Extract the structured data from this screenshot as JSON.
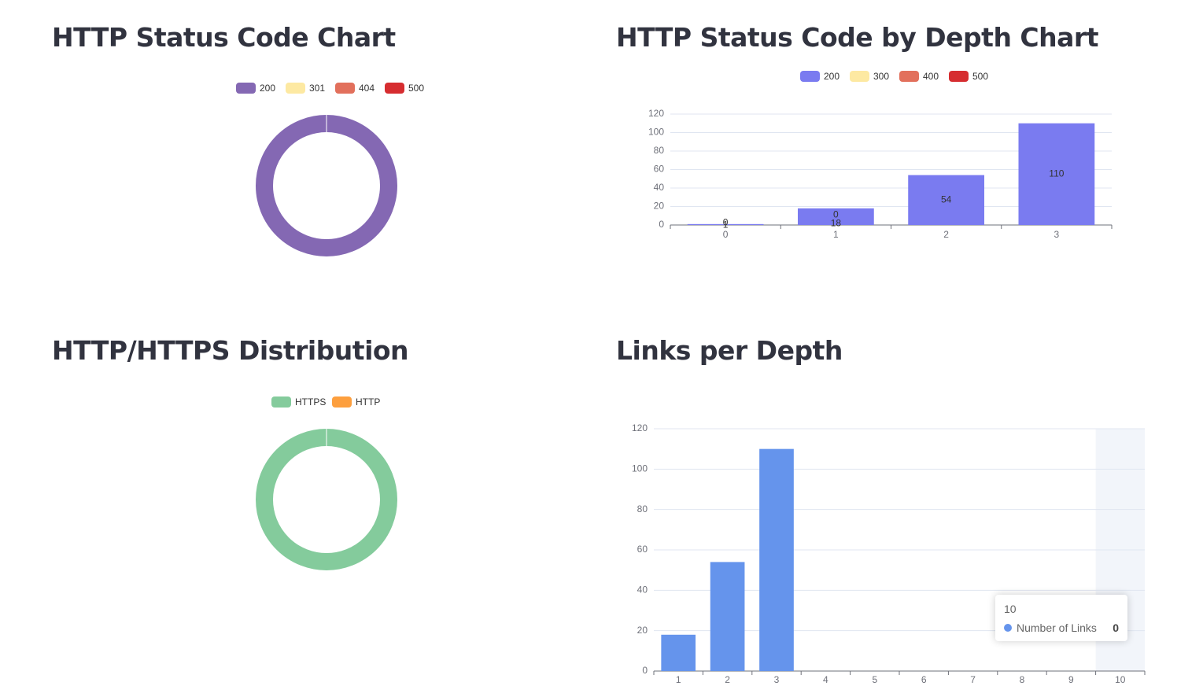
{
  "panels": {
    "status": {
      "title": "HTTP Status Code Chart"
    },
    "depth": {
      "title": "HTTP Status Code by Depth Chart"
    },
    "protocol": {
      "title": "HTTP/HTTPS Distribution"
    },
    "links": {
      "title": "Links per Depth"
    }
  },
  "chart_data": [
    {
      "type": "pie",
      "title": "HTTP Status Code Chart",
      "labels": [
        "200",
        "301",
        "404",
        "500"
      ],
      "values": [
        183,
        0,
        0,
        0
      ],
      "colors": [
        "#8468b3",
        "#fde9a2",
        "#e2705c",
        "#d62d30"
      ],
      "legend": "top"
    },
    {
      "type": "bar",
      "title": "HTTP Status Code by Depth Chart",
      "categories": [
        "0",
        "1",
        "2",
        "3"
      ],
      "series": [
        {
          "name": "200",
          "values": [
            1,
            18,
            54,
            110
          ],
          "color": "#7a7bf0"
        },
        {
          "name": "300",
          "values": [
            0,
            0,
            0,
            0
          ],
          "color": "#fde9a2"
        },
        {
          "name": "400",
          "values": [
            0,
            0,
            0,
            0
          ],
          "color": "#e2705c"
        },
        {
          "name": "500",
          "values": [
            0,
            0,
            0,
            0
          ],
          "color": "#d62d30"
        }
      ],
      "visible_labels": [
        {
          "category": "0",
          "texts": [
            "0",
            "1"
          ]
        },
        {
          "category": "1",
          "texts": [
            "0",
            "18"
          ]
        },
        {
          "category": "2",
          "texts": [
            "54"
          ]
        },
        {
          "category": "3",
          "texts": [
            "110"
          ]
        }
      ],
      "yticks": [
        "0",
        "20",
        "40",
        "60",
        "80",
        "100",
        "120"
      ],
      "ylim": [
        0,
        120
      ],
      "legend": "top"
    },
    {
      "type": "pie",
      "title": "HTTP/HTTPS Distribution",
      "labels": [
        "HTTPS",
        "HTTP"
      ],
      "values": [
        183,
        0
      ],
      "colors": [
        "#84cb9c",
        "#fd9f3e"
      ],
      "legend": "top"
    },
    {
      "type": "bar",
      "title": "Links per Depth",
      "categories": [
        "1",
        "2",
        "3",
        "4",
        "5",
        "6",
        "7",
        "8",
        "9",
        "10"
      ],
      "series": [
        {
          "name": "Number of Links",
          "values": [
            18,
            54,
            110,
            0,
            0,
            0,
            0,
            0,
            0,
            0
          ],
          "color": "#6594ec"
        }
      ],
      "yticks": [
        "0",
        "20",
        "40",
        "60",
        "80",
        "100",
        "120"
      ],
      "ylim": [
        0,
        120
      ],
      "highlighted_category": "10",
      "tooltip": {
        "title": "10",
        "series": "Number of Links",
        "value": "0",
        "color": "#6594ec"
      }
    }
  ]
}
